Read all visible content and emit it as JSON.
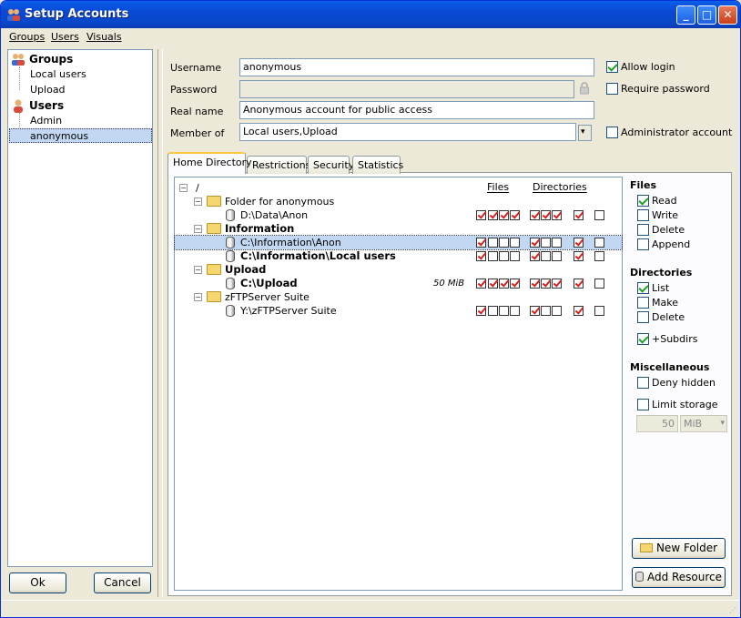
{
  "window": {
    "title": "Setup Accounts"
  },
  "menu": [
    "Groups",
    "Users",
    "Visuals"
  ],
  "left_tree": {
    "groups_label": "Groups",
    "groups": [
      "Local users",
      "Upload"
    ],
    "users_label": "Users",
    "users": [
      "Admin",
      "anonymous"
    ],
    "selected": "anonymous"
  },
  "buttons": {
    "ok": "Ok",
    "cancel": "Cancel",
    "new_folder": "New Folder",
    "add_resource": "Add Resource"
  },
  "form": {
    "username_label": "Username",
    "username": "anonymous",
    "password_label": "Password",
    "password": "",
    "realname_label": "Real name",
    "realname": "Anonymous account for public access",
    "member_label": "Member of",
    "member": "Local users,Upload",
    "allow_login": "Allow login",
    "require_password": "Require password",
    "admin_account": "Administrator account"
  },
  "tabs": [
    "Home Directory",
    "Restrictions",
    "Security",
    "Statistics"
  ],
  "dir_headers": {
    "files": "Files",
    "directories": "Directories"
  },
  "dir_tree": [
    {
      "label": "/",
      "level": 0,
      "kind": "root",
      "bold": false
    },
    {
      "label": "Folder for anonymous",
      "level": 1,
      "kind": "folder",
      "bold": false
    },
    {
      "label": "D:\\Data\\Anon",
      "level": 2,
      "kind": "resource",
      "bold": false,
      "perms": [
        1,
        1,
        1,
        1,
        1,
        1,
        1,
        1,
        0
      ]
    },
    {
      "label": "Information",
      "level": 1,
      "kind": "folder",
      "bold": true
    },
    {
      "label": "C:\\Information\\Anon",
      "level": 2,
      "kind": "resource",
      "bold": false,
      "perms": [
        1,
        0,
        0,
        0,
        1,
        0,
        0,
        1,
        0
      ],
      "selected": true
    },
    {
      "label": "C:\\Information\\Local users",
      "level": 2,
      "kind": "resource",
      "bold": true,
      "perms": [
        1,
        0,
        0,
        0,
        1,
        0,
        0,
        1,
        0
      ]
    },
    {
      "label": "Upload",
      "level": 1,
      "kind": "folder",
      "bold": true
    },
    {
      "label": "C:\\Upload",
      "level": 2,
      "kind": "resource",
      "bold": true,
      "size": "50 MiB",
      "perms": [
        1,
        1,
        1,
        1,
        1,
        1,
        1,
        1,
        0
      ]
    },
    {
      "label": "zFTPServer Suite",
      "level": 1,
      "kind": "folder",
      "bold": false
    },
    {
      "label": "Y:\\zFTPServer Suite",
      "level": 2,
      "kind": "resource",
      "bold": false,
      "perms": [
        1,
        0,
        0,
        0,
        1,
        0,
        0,
        1,
        0
      ]
    }
  ],
  "right_panel": {
    "files_title": "Files",
    "files": [
      {
        "label": "Read",
        "checked": true
      },
      {
        "label": "Write",
        "checked": false
      },
      {
        "label": "Delete",
        "checked": false
      },
      {
        "label": "Append",
        "checked": false
      }
    ],
    "dirs_title": "Directories",
    "dirs": [
      {
        "label": "List",
        "checked": true
      },
      {
        "label": "Make",
        "checked": false
      },
      {
        "label": "Delete",
        "checked": false
      }
    ],
    "subdirs": {
      "label": "+Subdirs",
      "checked": true
    },
    "misc_title": "Miscellaneous",
    "deny_hidden": "Deny hidden",
    "limit_storage": "Limit storage",
    "storage_value": "50",
    "storage_unit": "MiB"
  }
}
